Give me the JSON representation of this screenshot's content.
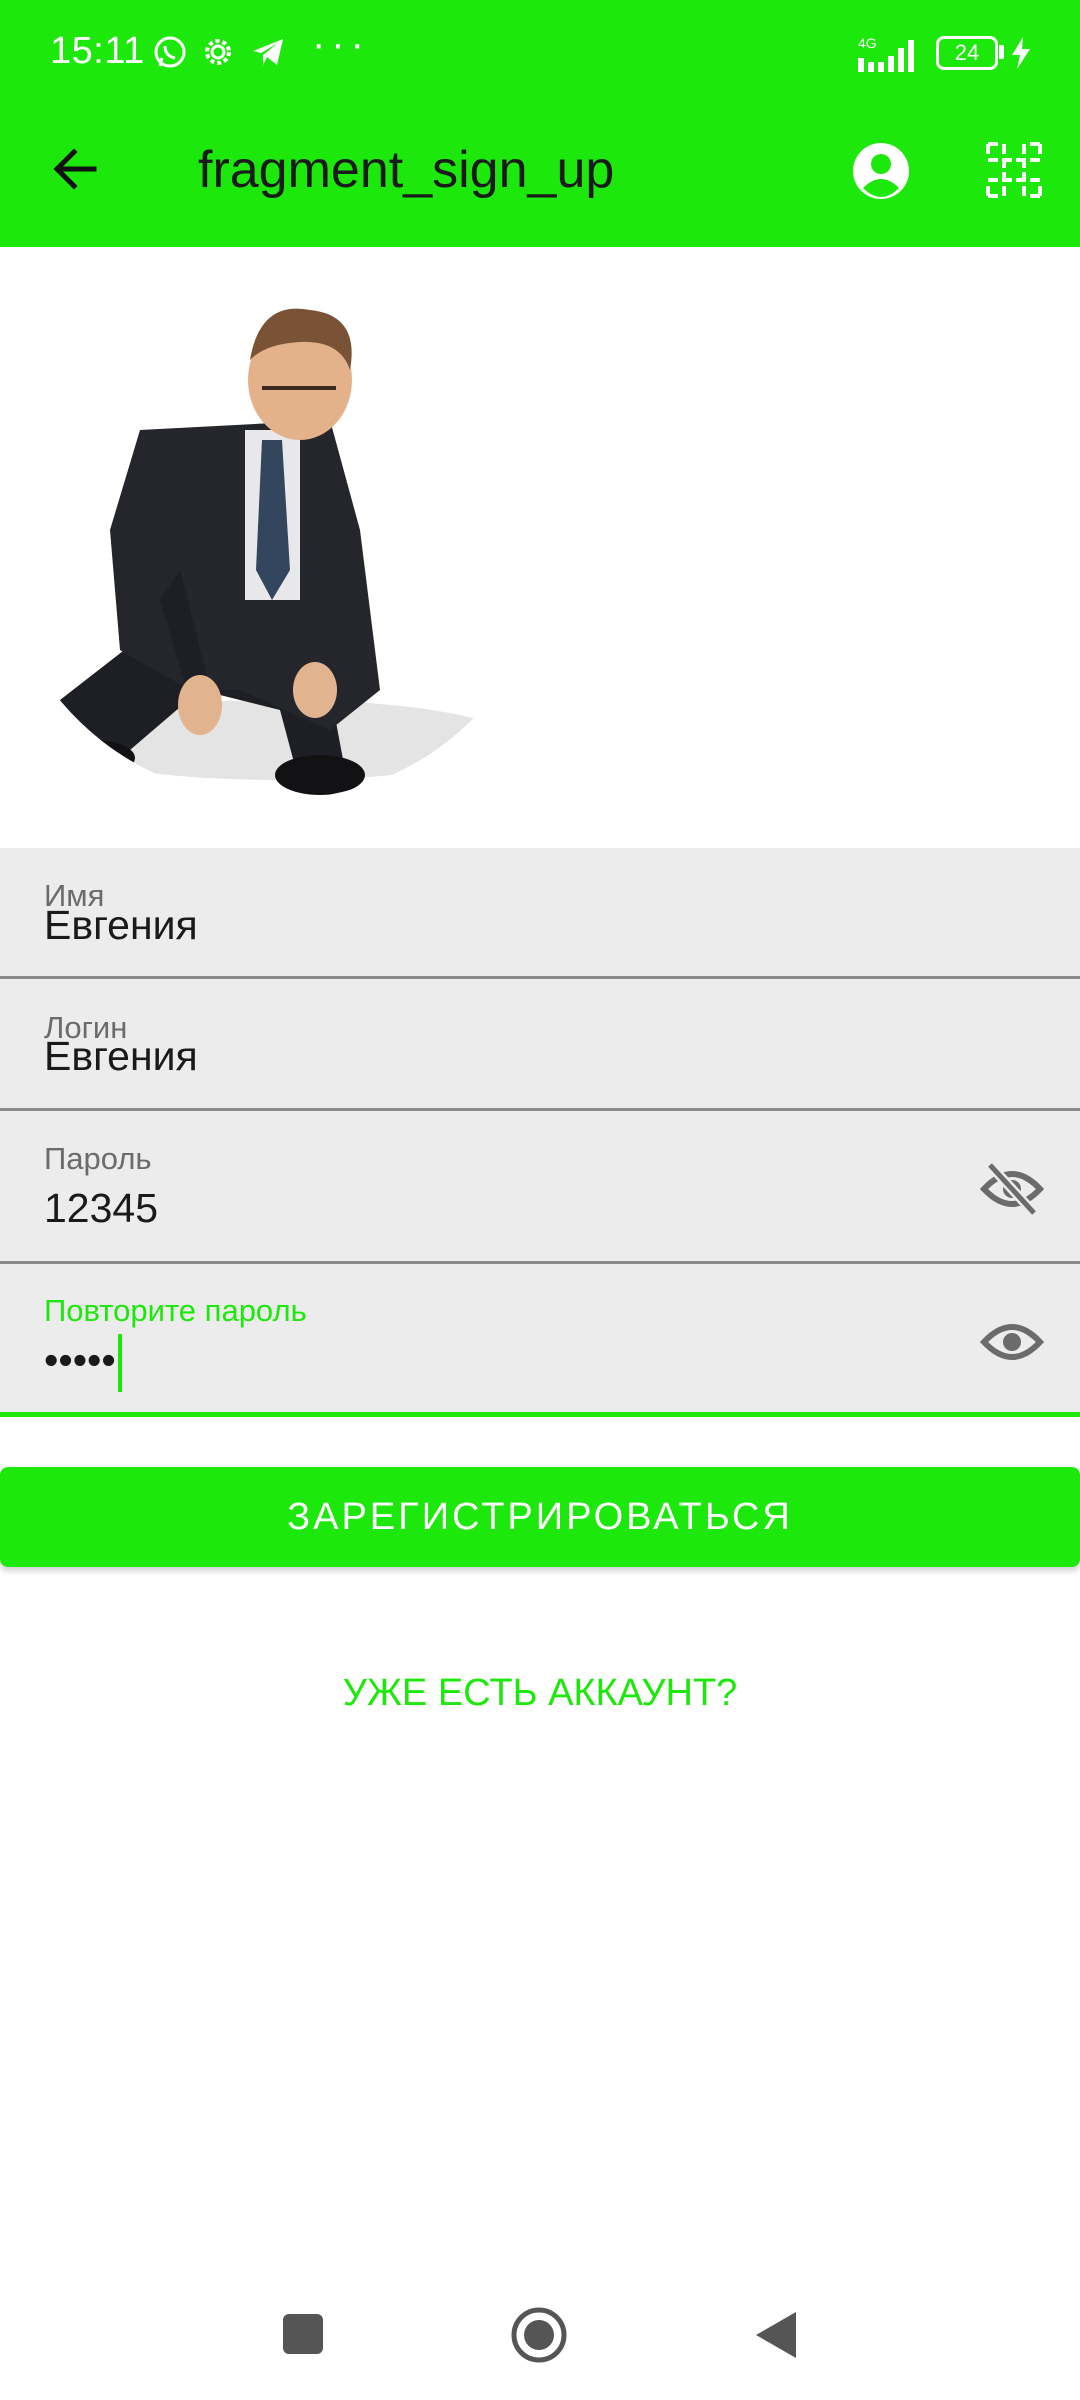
{
  "status_bar": {
    "time": "15:11",
    "icons": [
      "whatsapp-icon",
      "settings-icon",
      "telegram-icon",
      "more-dots-icon",
      "signal-4g-icon",
      "battery-icon",
      "charging-icon"
    ],
    "more": "···",
    "network": "4G",
    "battery_level": "24"
  },
  "app_bar": {
    "title": "fragment_sign_up",
    "icons": [
      "back-arrow-icon",
      "account-circle-icon",
      "grid-icon"
    ]
  },
  "form": {
    "name": {
      "label": "Имя",
      "value": "Евгения"
    },
    "login": {
      "label": "Логин",
      "value": "Евгения"
    },
    "password": {
      "label": "Пароль",
      "value": "12345",
      "toggle_icon": "visibility-off-icon"
    },
    "repeat_password": {
      "label": "Повторите пароль",
      "value": "•••••",
      "toggle_icon": "visibility-icon"
    }
  },
  "register_button": "ЗАРЕГИСТРИРОВАТЬСЯ",
  "have_account_link": "УЖЕ ЕСТЬ АККАУНТ?",
  "colors": {
    "accent": "#1de80b",
    "field_bg": "#ececec",
    "text": "#1a1a1a"
  }
}
